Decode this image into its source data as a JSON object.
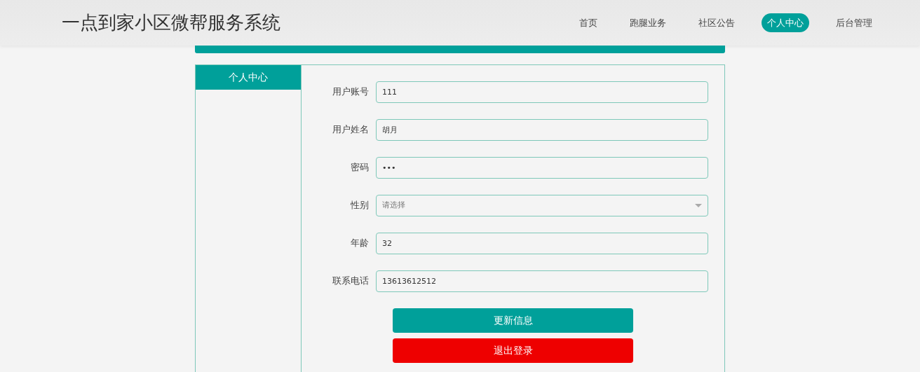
{
  "site_title": "一点到家小区微帮服务系统",
  "nav": [
    {
      "label": "首页",
      "selected": false
    },
    {
      "label": "跑腿业务",
      "selected": false
    },
    {
      "label": "社区公告",
      "selected": false
    },
    {
      "label": "个人中心",
      "selected": true
    },
    {
      "label": "后台管理",
      "selected": false
    }
  ],
  "sidebar": {
    "title": "个人中心"
  },
  "form": {
    "fields": [
      {
        "label": "用户账号",
        "kind": "text",
        "value": "111"
      },
      {
        "label": "用户姓名",
        "kind": "text",
        "value": "胡月"
      },
      {
        "label": "密码",
        "kind": "text",
        "value": "•••"
      },
      {
        "label": "性别",
        "kind": "select",
        "placeholder": "请选择"
      },
      {
        "label": "年龄",
        "kind": "text",
        "value": "32"
      },
      {
        "label": "联系电话",
        "kind": "text",
        "value": "13613612512"
      }
    ],
    "buttons": [
      {
        "label": "更新信息",
        "kind": "primary"
      },
      {
        "label": "退出登录",
        "kind": "danger"
      }
    ]
  }
}
